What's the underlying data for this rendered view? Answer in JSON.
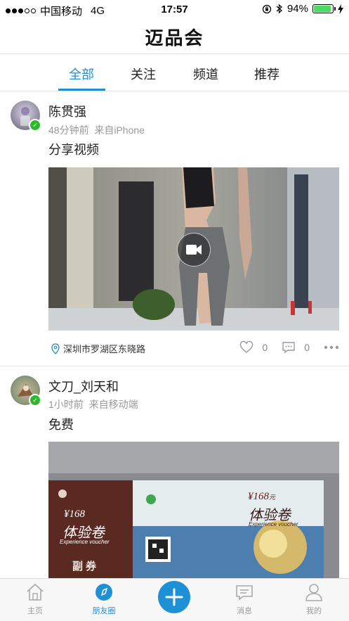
{
  "status_bar": {
    "carrier": "中国移动",
    "network": "4G",
    "time": "17:57",
    "battery": "94%",
    "battery_level": 0.94
  },
  "header": {
    "title": "迈品会"
  },
  "tabs": [
    {
      "label": "全部",
      "active": true
    },
    {
      "label": "关注"
    },
    {
      "label": "频道"
    },
    {
      "label": "推荐"
    }
  ],
  "posts": [
    {
      "username": "陈贯强",
      "time": "48分钟前",
      "source": "来自iPhone",
      "text": "分享视频",
      "media_type": "video",
      "location": "深圳市罗湖区东晓路",
      "likes": "0",
      "comments": "0"
    },
    {
      "username": "文刀_刘天和",
      "time": "1小时前",
      "source": "来自移动端",
      "text": "免费",
      "media_type": "image",
      "voucher_price": "¥168",
      "voucher_unit": "元",
      "voucher_title": "体验卷",
      "voucher_sub": "Experience voucher",
      "voucher_stub": "副券"
    }
  ],
  "tabbar": [
    {
      "label": "主页",
      "icon": "home-icon"
    },
    {
      "label": "朋友圈",
      "icon": "compass-icon",
      "active": true
    },
    {
      "label": "",
      "icon": "plus-icon"
    },
    {
      "label": "消息",
      "icon": "message-icon"
    },
    {
      "label": "我的",
      "icon": "person-icon"
    }
  ],
  "colors": {
    "accent": "#1e90d6",
    "verified": "#2eb82e"
  }
}
